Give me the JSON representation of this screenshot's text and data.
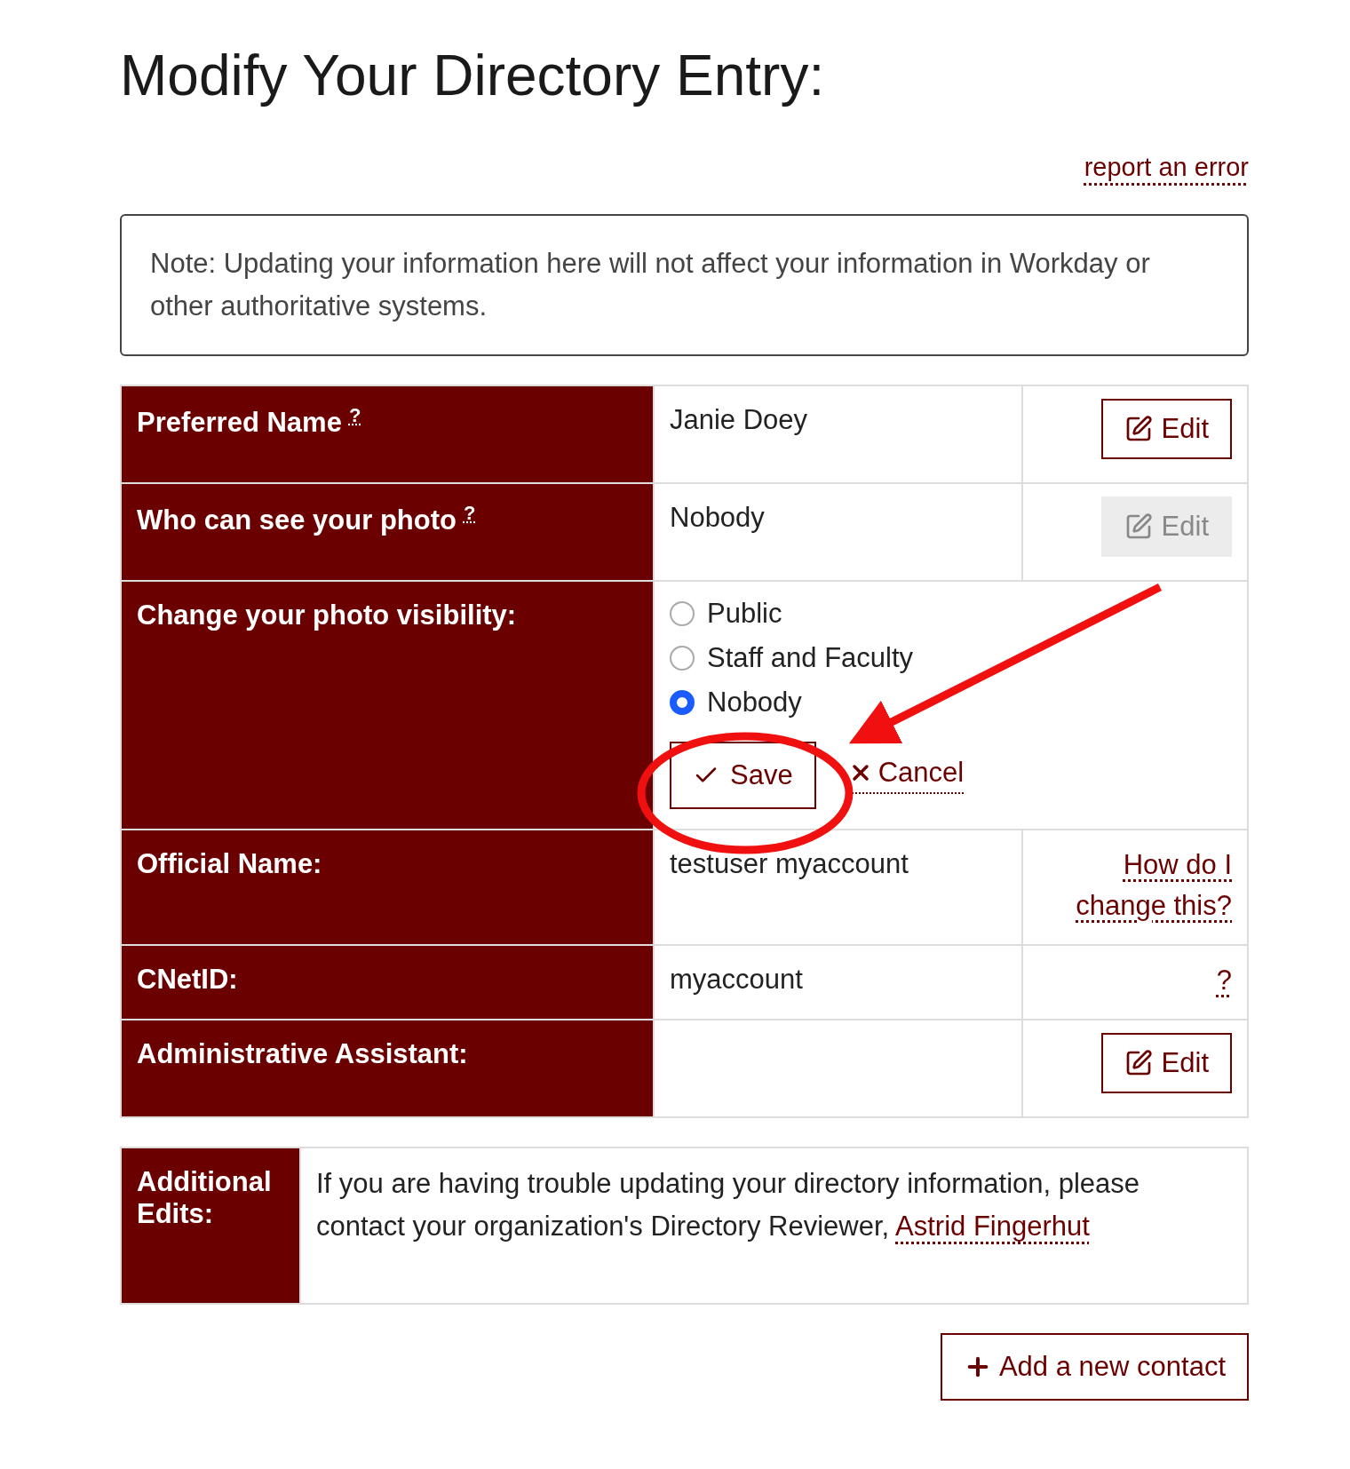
{
  "title": "Modify Your Directory Entry:",
  "report_link": "report an error",
  "note": "Note: Updating your information here will not affect your information in Workday or other authoritative systems.",
  "rows": [
    {
      "kind": "editable",
      "label": "Preferred Name",
      "help": "?",
      "value": "Janie Doey",
      "action": {
        "label": "Edit",
        "disabled": false
      }
    },
    {
      "kind": "editable",
      "label": "Who can see your photo",
      "help": "?",
      "value": "Nobody",
      "action": {
        "label": "Edit",
        "disabled": true
      }
    },
    {
      "kind": "choice",
      "label": "Change your photo visibility:",
      "options": [
        {
          "label": "Public",
          "selected": false
        },
        {
          "label": "Staff and Faculty",
          "selected": false
        },
        {
          "label": "Nobody",
          "selected": true
        }
      ],
      "save": "Save",
      "cancel": "Cancel"
    },
    {
      "kind": "link",
      "label": "Official Name:",
      "value": "testuser myaccount",
      "link": "How do I change this?"
    },
    {
      "kind": "link",
      "label": "CNetID:",
      "value": "myaccount",
      "link": "?"
    },
    {
      "kind": "editable",
      "label": "Administrative Assistant:",
      "action": {
        "label": "Edit",
        "disabled": false
      }
    }
  ],
  "additional": {
    "label": "Additional Edits:",
    "text": "If you are having trouble updating your directory information, please contact your organization's Directory Reviewer, ",
    "link": "Astrid Fingerhut"
  },
  "add_button": "Add a new contact",
  "annotation": {
    "kind": "circle-arrow"
  }
}
